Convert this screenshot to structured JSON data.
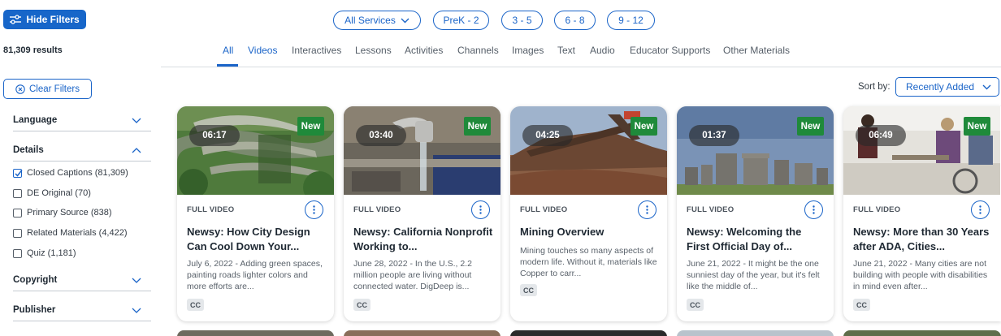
{
  "filters": {
    "hide_label": "Hide Filters",
    "results": "81,309 results",
    "clear_label": "Clear Filters"
  },
  "pills": {
    "services": "All Services",
    "grades": [
      "PreK - 2",
      "3 - 5",
      "6 - 8",
      "9 - 12"
    ]
  },
  "tabs": [
    "All",
    "Videos",
    "Interactives",
    "Lessons",
    "Activities",
    "Channels",
    "Images",
    "Text",
    "Audio",
    "Educator Supports",
    "Other Materials"
  ],
  "sidebar": {
    "language": "Language",
    "details": "Details",
    "options": [
      {
        "label": "Closed Captions (81,309)",
        "checked": true
      },
      {
        "label": "DE Original (70)",
        "checked": false
      },
      {
        "label": "Primary Source (838)",
        "checked": false
      },
      {
        "label": "Related Materials (4,422)",
        "checked": false
      },
      {
        "label": "Quiz (1,181)",
        "checked": false
      }
    ],
    "copyright": "Copyright",
    "publisher": "Publisher"
  },
  "sort": {
    "label": "Sort by:",
    "value": "Recently Added"
  },
  "cards": [
    {
      "duration": "06:17",
      "badge": "New",
      "type": "FULL VIDEO",
      "title": "Newsy: How City Design Can Cool Down Your...",
      "desc": "July 6, 2022 - Adding green spaces, painting roads lighter colors and more efforts are...",
      "tag": "CC"
    },
    {
      "duration": "03:40",
      "badge": "New",
      "type": "FULL VIDEO",
      "title": "Newsy: California Nonprofit Working to...",
      "desc": "June 28, 2022 - In the U.S., 2.2 million people are living without connected water. DigDeep is...",
      "tag": "CC"
    },
    {
      "duration": "04:25",
      "badge": "New",
      "type": "FULL VIDEO",
      "title": "Mining Overview",
      "desc": "Mining touches so many aspects of modern life. Without it, materials like Copper to carr...",
      "tag": "CC"
    },
    {
      "duration": "01:37",
      "badge": "New",
      "type": "FULL VIDEO",
      "title": "Newsy: Welcoming the First Official Day of...",
      "desc": "June 21, 2022 - It might be the one sunniest day of the year, but it's felt like the middle of...",
      "tag": "CC"
    },
    {
      "duration": "06:49",
      "badge": "New",
      "type": "FULL VIDEO",
      "title": "Newsy: More than 30 Years after ADA, Cities...",
      "desc": "June 21, 2022 - Many cities are not building with people with disabilities in mind even after...",
      "tag": "CC"
    }
  ],
  "colors": {
    "accent": "#1a64c8",
    "badge_green": "#1f8a3a",
    "hide_button": "#1766c9"
  },
  "icons": {
    "hide_filters": "sliders-icon",
    "clear_filters": "circle-x-icon",
    "more": "vertical-dots-icon",
    "chevron": "chevron-down-icon"
  }
}
